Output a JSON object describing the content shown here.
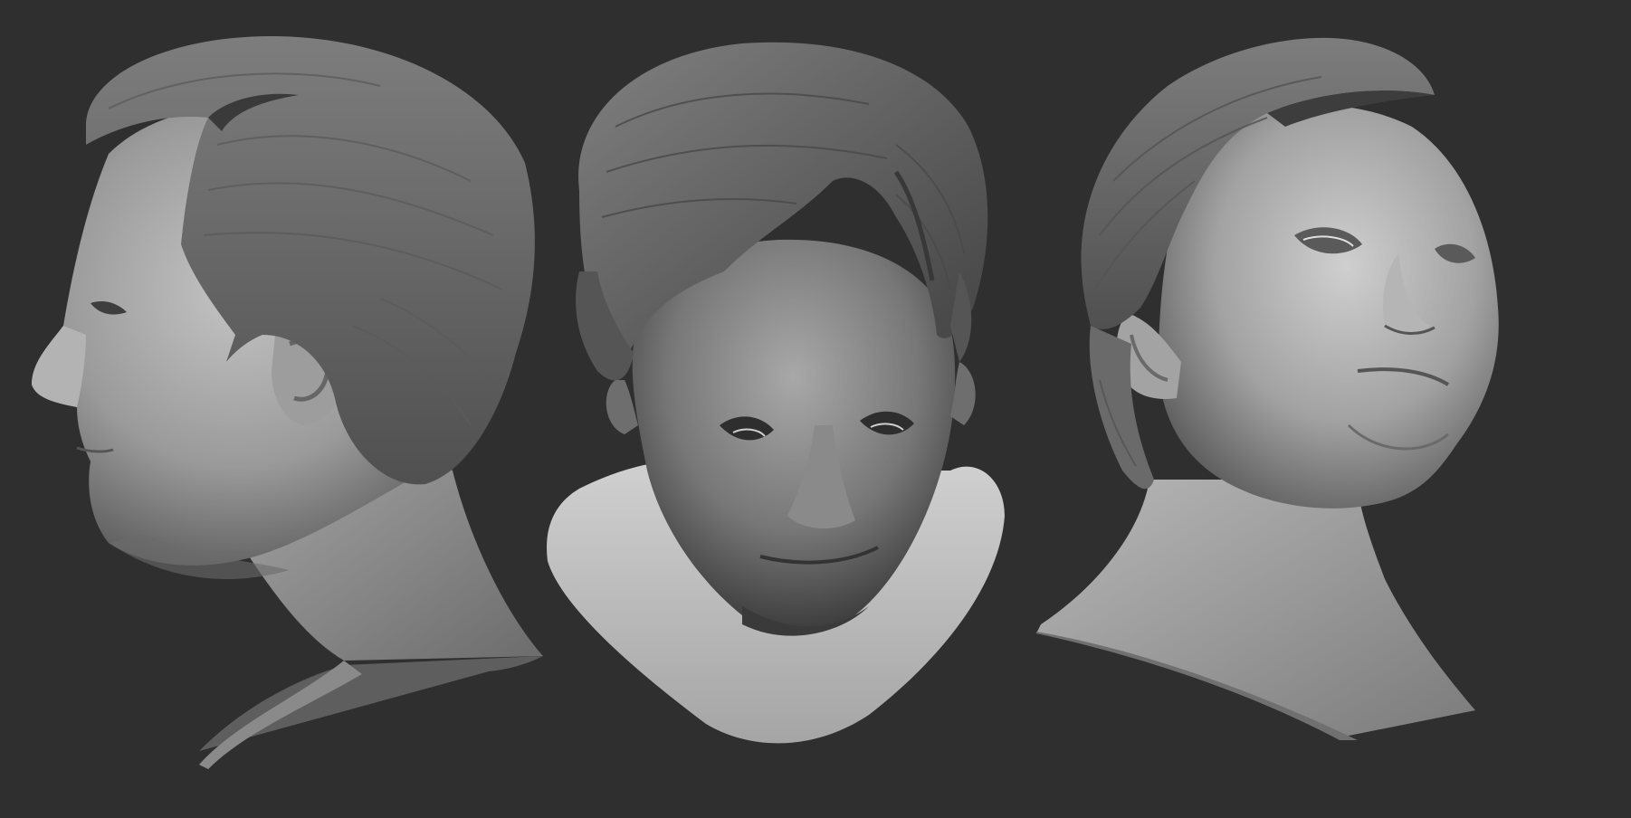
{
  "scene": {
    "background_color": "#2f2f30",
    "material": "clay-grey",
    "model_colors": {
      "skin_light": "#bcbcbc",
      "skin_mid": "#8f8f8f",
      "skin_dark": "#4a4a4a",
      "hair": "#6f6f6f",
      "hair_dark": "#3f3f3f"
    },
    "views": [
      {
        "name": "left-profile"
      },
      {
        "name": "front-down"
      },
      {
        "name": "three-quarter-right-up"
      }
    ]
  }
}
